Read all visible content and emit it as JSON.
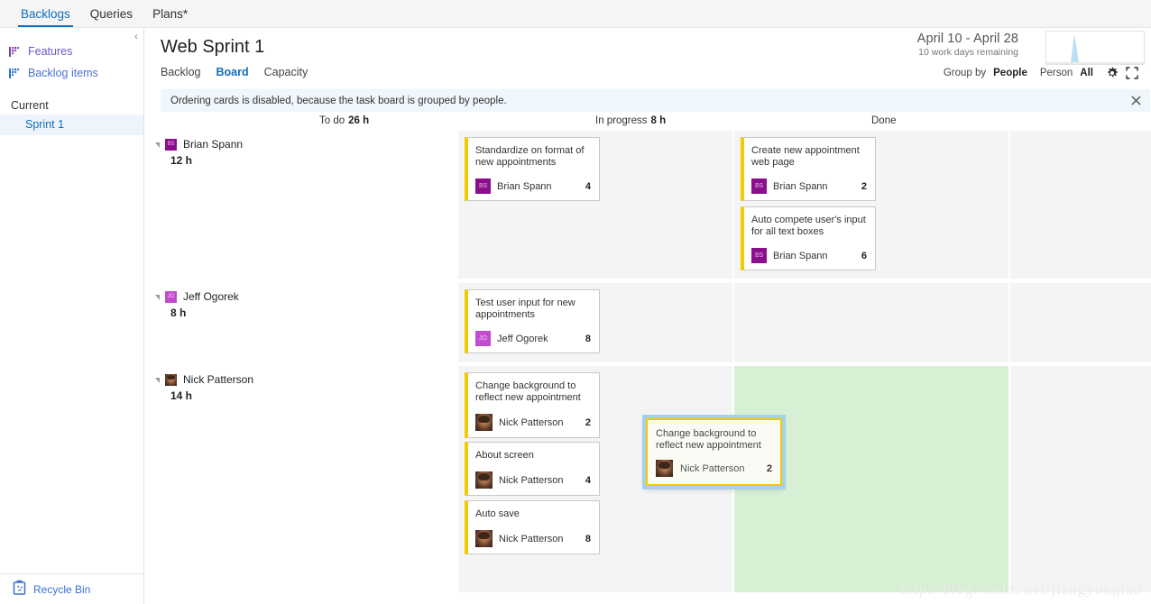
{
  "topnav": {
    "items": [
      {
        "label": "Backlogs",
        "active": true
      },
      {
        "label": "Queries",
        "active": false
      },
      {
        "label": "Plans*",
        "active": false
      }
    ]
  },
  "sidebar": {
    "collapse_icon": "chevron-left-icon",
    "links": [
      {
        "label": "Features",
        "icon": "flag-purple-icon"
      },
      {
        "label": "Backlog items",
        "icon": "flag-blue-icon"
      }
    ],
    "section_header": "Current",
    "sprint": "Sprint 1",
    "recycle_bin": {
      "label": "Recycle Bin",
      "icon": "recycle-bin-icon"
    }
  },
  "header": {
    "title": "Web Sprint 1",
    "subtabs": [
      {
        "label": "Backlog",
        "active": false
      },
      {
        "label": "Board",
        "active": true
      },
      {
        "label": "Capacity",
        "active": false
      }
    ],
    "date_range": "April 10 - April 28",
    "days_remaining": "10 work days remaining",
    "burndown_icon": "burndown-sparkline"
  },
  "toolbar": {
    "group_by_label": "Group by",
    "group_by_value": "People",
    "person_label": "Person",
    "person_value": "All",
    "settings_icon": "gear-icon",
    "fullscreen_icon": "fullscreen-icon"
  },
  "infobar": {
    "message": "Ordering cards is disabled, because the task board is grouped by people.",
    "close_icon": "close-icon"
  },
  "columns": [
    {
      "name": "To do",
      "hours": "26 h"
    },
    {
      "name": "In progress",
      "hours": "8 h"
    },
    {
      "name": "Done",
      "hours": ""
    }
  ],
  "swimlanes": [
    {
      "person": "Brian Spann",
      "hours": "12 h",
      "avatar": "av-bs",
      "todo": [
        {
          "title": "Standardize on format of new appointments",
          "assignee": "Brian Spann",
          "points": "4",
          "avatar": "av-bs"
        }
      ],
      "inprogress": [
        {
          "title": "Create new appointment web page",
          "assignee": "Brian Spann",
          "points": "2",
          "avatar": "av-bs"
        },
        {
          "title": "Auto compete user's input for all text boxes",
          "assignee": "Brian Spann",
          "points": "6",
          "avatar": "av-bs"
        }
      ],
      "done": []
    },
    {
      "person": "Jeff Ogorek",
      "hours": "8 h",
      "avatar": "av-jo",
      "todo": [
        {
          "title": "Test user input for new appointments",
          "assignee": "Jeff Ogorek",
          "points": "8",
          "avatar": "av-jo"
        }
      ],
      "inprogress": [],
      "done": []
    },
    {
      "person": "Nick Patterson",
      "hours": "14 h",
      "avatar": "av-np",
      "todo": [
        {
          "title": "Change background to reflect new appointment",
          "assignee": "Nick Patterson",
          "points": "2",
          "avatar": "av-np"
        },
        {
          "title": "About screen",
          "assignee": "Nick Patterson",
          "points": "4",
          "avatar": "av-np"
        },
        {
          "title": "Auto save",
          "assignee": "Nick Patterson",
          "points": "8",
          "avatar": "av-np"
        }
      ],
      "inprogress": [],
      "done": []
    }
  ],
  "drag_card": {
    "title": "Change background to reflect new appointment",
    "assignee": "Nick Patterson",
    "points": "2",
    "avatar": "av-np"
  },
  "watermark": "http://blog. csdn. net/jiangyongtao",
  "colors": {
    "accent_blue": "#106ebe",
    "card_border_yellow": "#f2cb00",
    "drop_green": "#d7f0d4",
    "avatar_purple": "#8b0f8b",
    "avatar_orchid": "#c24bd0",
    "info_bar_blue": "#eff6fc"
  }
}
